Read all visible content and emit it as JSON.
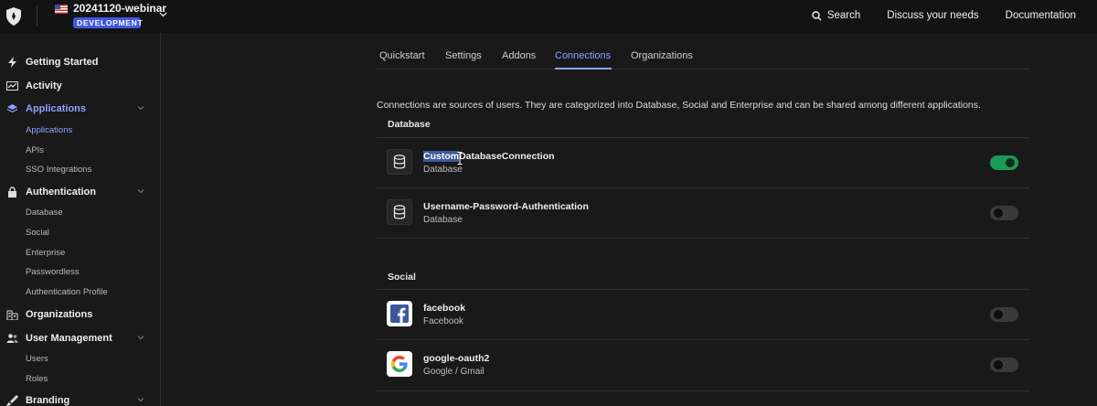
{
  "header": {
    "tenant_name": "20241120-webinar",
    "environment": "DEVELOPMENT",
    "search_label": "Search",
    "discuss_label": "Discuss your needs",
    "docs_label": "Documentation"
  },
  "sidebar": {
    "items": [
      {
        "label": "Getting Started",
        "icon": "lightning-icon"
      },
      {
        "label": "Activity",
        "icon": "activity-chart-icon"
      },
      {
        "label": "Applications",
        "icon": "layers-icon",
        "active": true,
        "sub": [
          "Applications",
          "APIs",
          "SSO Integrations"
        ]
      },
      {
        "label": "Authentication",
        "icon": "lock-icon",
        "sub": [
          "Database",
          "Social",
          "Enterprise",
          "Passwordless",
          "Authentication Profile"
        ]
      },
      {
        "label": "Organizations",
        "icon": "building-icon"
      },
      {
        "label": "User Management",
        "icon": "users-icon",
        "sub": [
          "Users",
          "Roles"
        ]
      },
      {
        "label": "Branding",
        "icon": "brush-icon"
      }
    ]
  },
  "tabs": [
    "Quickstart",
    "Settings",
    "Addons",
    "Connections",
    "Organizations"
  ],
  "active_tab": "Connections",
  "intro": "Connections are sources of users. They are categorized into Database, Social and Enterprise and can be shared among different applications.",
  "sections": {
    "database": {
      "title": "Database",
      "connections": [
        {
          "name_selected": "Custom",
          "name_rest": "DatabaseConnection",
          "type": "Database",
          "enabled": true,
          "icon": "database-icon"
        },
        {
          "name": "Username-Password-Authentication",
          "type": "Database",
          "enabled": false,
          "icon": "database-icon"
        }
      ]
    },
    "social": {
      "title": "Social",
      "connections": [
        {
          "name": "facebook",
          "type": "Facebook",
          "enabled": false,
          "icon": "facebook-icon"
        },
        {
          "name": "google-oauth2",
          "type": "Google / Gmail",
          "enabled": false,
          "icon": "google-icon"
        }
      ]
    }
  },
  "colors": {
    "accent": "#8da2ff",
    "toggle_on": "#1a9a55",
    "badge": "#3f59e4",
    "background": "#191919"
  }
}
